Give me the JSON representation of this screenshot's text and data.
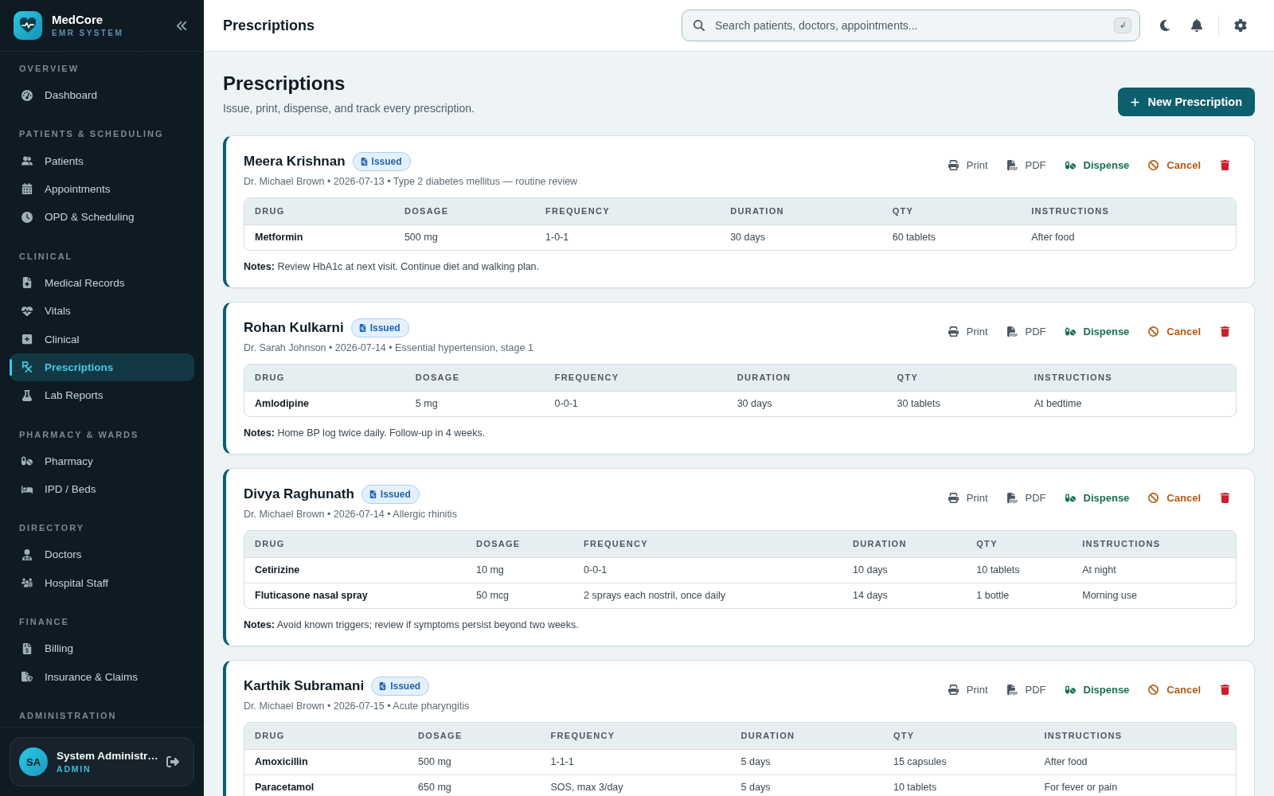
{
  "sidebar": {
    "brand": {
      "name": "MedCore",
      "subtitle": "EMR SYSTEM"
    },
    "sections": [
      {
        "title": "OVERVIEW",
        "items": [
          {
            "label": "Dashboard",
            "selected": false
          }
        ]
      },
      {
        "title": "PATIENTS & SCHEDULING",
        "items": [
          {
            "label": "Patients",
            "selected": false
          },
          {
            "label": "Appointments",
            "selected": false
          },
          {
            "label": "OPD & Scheduling",
            "selected": false
          }
        ]
      },
      {
        "title": "CLINICAL",
        "items": [
          {
            "label": "Medical Records",
            "selected": false
          },
          {
            "label": "Vitals",
            "selected": false
          },
          {
            "label": "Clinical",
            "selected": false
          },
          {
            "label": "Prescriptions",
            "selected": true
          },
          {
            "label": "Lab Reports",
            "selected": false
          }
        ]
      },
      {
        "title": "PHARMACY & WARDS",
        "items": [
          {
            "label": "Pharmacy",
            "selected": false
          },
          {
            "label": "IPD / Beds",
            "selected": false
          }
        ]
      },
      {
        "title": "DIRECTORY",
        "items": [
          {
            "label": "Doctors",
            "selected": false
          },
          {
            "label": "Hospital Staff",
            "selected": false
          }
        ]
      },
      {
        "title": "FINANCE",
        "items": [
          {
            "label": "Billing",
            "selected": false
          },
          {
            "label": "Insurance & Claims",
            "selected": false
          }
        ]
      },
      {
        "title": "ADMINISTRATION"
      }
    ],
    "user": {
      "initials": "SA",
      "name": "System Administr…",
      "role": "ADMIN"
    }
  },
  "header": {
    "title": "Prescriptions",
    "search": {
      "placeholder": "Search patients, doctors, appointments..."
    }
  },
  "page": {
    "title": "Prescriptions",
    "subtitle": "Issue, print, dispense, and track every prescription.",
    "primary_action": "New Prescription"
  },
  "prescriptions": [
    {
      "patient": "Meera Krishnan",
      "status": "Issued",
      "meta": "Dr. Michael Brown • 2026-07-13 • Type 2 diabetes mellitus — routine review",
      "actions": [
        {
          "kind": "print",
          "label": "Print"
        },
        {
          "kind": "pdf",
          "label": "PDF"
        },
        {
          "kind": "dispense",
          "label": "Dispense"
        },
        {
          "kind": "cancel",
          "label": "Cancel"
        },
        {
          "kind": "delete"
        }
      ],
      "columns": [
        "DRUG",
        "DOSAGE",
        "FREQUENCY",
        "DURATION",
        "QTY",
        "INSTRUCTIONS"
      ],
      "rows": [
        [
          "Metformin",
          "500 mg",
          "1-0-1",
          "30 days",
          "60 tablets",
          "After food"
        ]
      ],
      "notes": "**Notes:** Review HbA1c at next visit. Continue diet and walking plan."
    },
    {
      "patient": "Rohan Kulkarni",
      "status": "Issued",
      "meta": "Dr. Sarah Johnson • 2026-07-14 • Essential hypertension, stage 1",
      "actions": [
        {
          "kind": "print",
          "label": "Print"
        },
        {
          "kind": "pdf",
          "label": "PDF"
        },
        {
          "kind": "dispense",
          "label": "Dispense"
        },
        {
          "kind": "cancel",
          "label": "Cancel"
        },
        {
          "kind": "delete"
        }
      ],
      "columns": [
        "DRUG",
        "DOSAGE",
        "FREQUENCY",
        "DURATION",
        "QTY",
        "INSTRUCTIONS"
      ],
      "rows": [
        [
          "Amlodipine",
          "5 mg",
          "0-0-1",
          "30 days",
          "30 tablets",
          "At bedtime"
        ]
      ],
      "notes": "**Notes:** Home BP log twice daily. Follow-up in 4 weeks."
    },
    {
      "patient": "Divya Raghunath",
      "status": "Issued",
      "meta": "Dr. Michael Brown • 2026-07-14 • Allergic rhinitis",
      "actions": [
        {
          "kind": "print",
          "label": "Print"
        },
        {
          "kind": "pdf",
          "label": "PDF"
        },
        {
          "kind": "dispense",
          "label": "Dispense"
        },
        {
          "kind": "cancel",
          "label": "Cancel"
        },
        {
          "kind": "delete"
        }
      ],
      "columns": [
        "DRUG",
        "DOSAGE",
        "FREQUENCY",
        "DURATION",
        "QTY",
        "INSTRUCTIONS"
      ],
      "rows": [
        [
          "Cetirizine",
          "10 mg",
          "0-0-1",
          "10 days",
          "10 tablets",
          "At night"
        ],
        [
          "Fluticasone nasal spray",
          "50 mcg",
          "2 sprays each nostril, once daily",
          "14 days",
          "1 bottle",
          "Morning use"
        ]
      ],
      "notes": "**Notes:** Avoid known triggers; review if symptoms persist beyond two weeks."
    },
    {
      "patient": "Karthik Subramani",
      "status": "Issued",
      "meta": "Dr. Michael Brown • 2026-07-15 • Acute pharyngitis",
      "actions": [
        {
          "kind": "print",
          "label": "Print"
        },
        {
          "kind": "pdf",
          "label": "PDF"
        },
        {
          "kind": "dispense",
          "label": "Dispense"
        },
        {
          "kind": "cancel",
          "label": "Cancel"
        },
        {
          "kind": "delete"
        }
      ],
      "columns": [
        "DRUG",
        "DOSAGE",
        "FREQUENCY",
        "DURATION",
        "QTY",
        "INSTRUCTIONS"
      ],
      "rows": [
        [
          "Amoxicillin",
          "500 mg",
          "1-1-1",
          "5 days",
          "15 capsules",
          "After food"
        ],
        [
          "Paracetamol",
          "650 mg",
          "SOS, max 3/day",
          "5 days",
          "10 tablets",
          "For fever or pain"
        ]
      ]
    }
  ]
}
